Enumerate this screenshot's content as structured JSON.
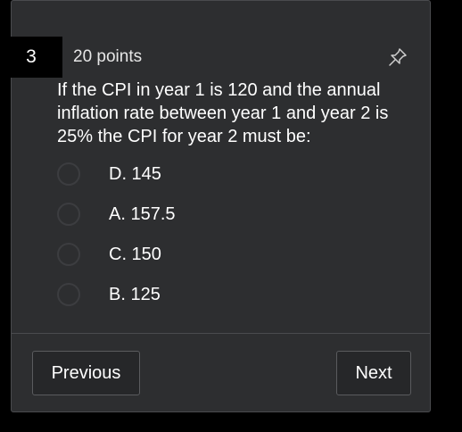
{
  "question": {
    "number": "3",
    "points": "20 points",
    "text": "If the CPI in year 1 is 120 and the annual inflation rate between year 1 and year 2 is 25% the CPI for year 2 must be:",
    "pin_icon": "pin-icon"
  },
  "options": [
    {
      "label": "D. 145",
      "selected": false
    },
    {
      "label": "A. 157.5",
      "selected": false
    },
    {
      "label": "C. 150",
      "selected": false
    },
    {
      "label": "B. 125",
      "selected": false
    }
  ],
  "nav": {
    "previous_label": "Previous",
    "next_label": "Next"
  },
  "colors": {
    "background": "#000000",
    "card": "#2d2e30",
    "text": "#ffffff"
  }
}
